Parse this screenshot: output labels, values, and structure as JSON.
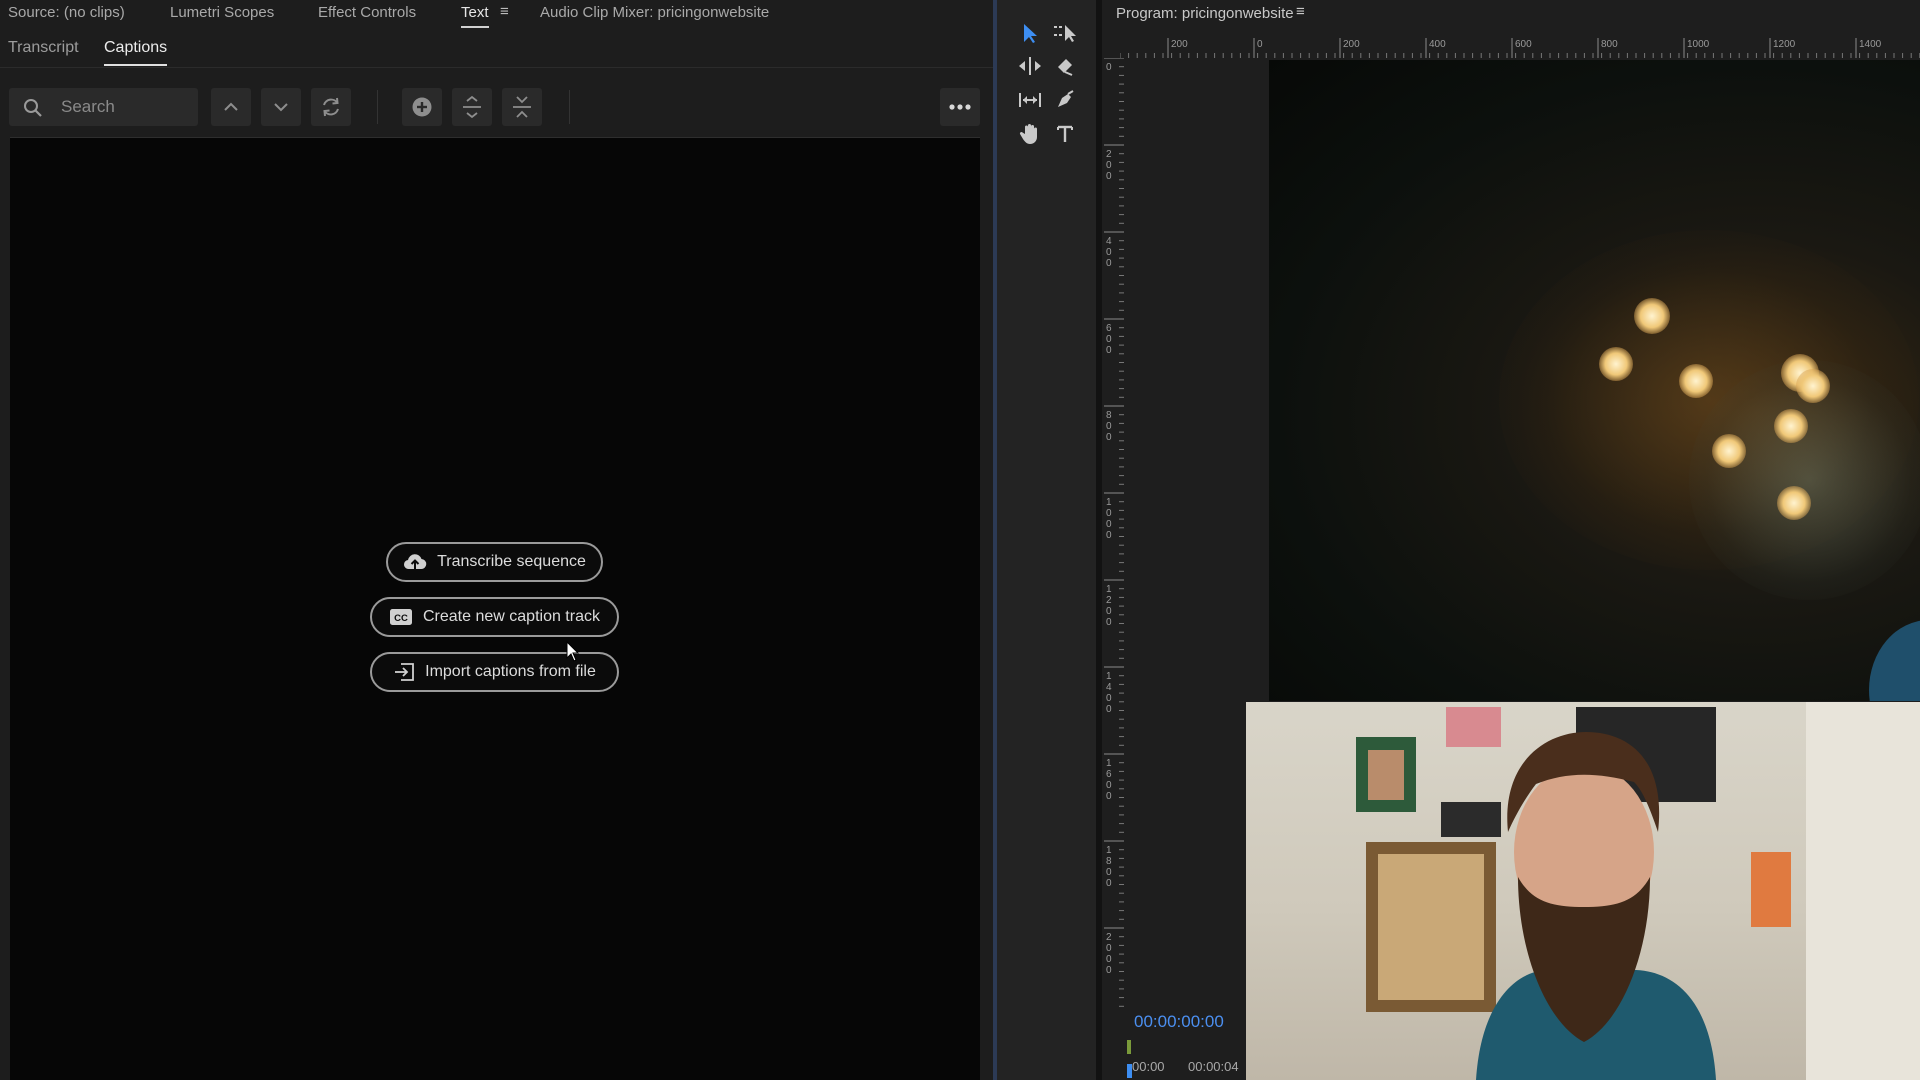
{
  "panel_tabs": [
    {
      "label": "Source: (no clips)"
    },
    {
      "label": "Lumetri Scopes"
    },
    {
      "label": "Effect Controls"
    },
    {
      "label": "Text"
    },
    {
      "label": "Audio Clip Mixer: pricingonwebsite"
    }
  ],
  "sub_tabs": [
    {
      "label": "Transcript"
    },
    {
      "label": "Captions"
    }
  ],
  "search": {
    "placeholder": "Search",
    "value": ""
  },
  "caption_actions": {
    "transcribe": "Transcribe sequence",
    "create": "Create new caption track",
    "import": "Import captions from file"
  },
  "program": {
    "title": "Program: pricingonwebsite",
    "timecode": "00:00:00:00",
    "time_start": "00:00",
    "time_end": "00:00:04"
  },
  "ruler": {
    "h_labels": [
      "200",
      "0",
      "200",
      "400",
      "600",
      "800",
      "1000",
      "1200",
      "1400"
    ],
    "v_labels": [
      "0",
      "2 0 0",
      "4 0 0",
      "6 0 0",
      "8 0 0",
      "1 0 0 0",
      "1 2 0 0",
      "1 4 0 0",
      "1 6 0 0",
      "1 8 0 0",
      "2 0 0 0"
    ]
  },
  "colors": {
    "accent": "#4b8ff0",
    "panel_bg": "#1d1d1d",
    "caption_bg": "#060606"
  }
}
